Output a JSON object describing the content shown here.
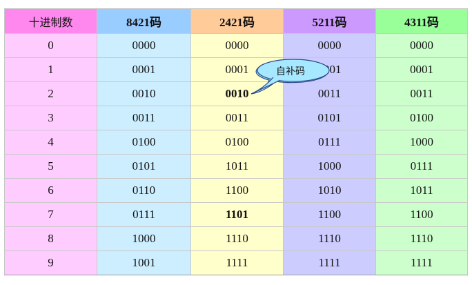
{
  "table": {
    "headers": [
      "十进制数",
      "8421码",
      "2421码",
      "5211码",
      "4311码"
    ],
    "rows": [
      [
        "0",
        "0000",
        "0000",
        "0000",
        "0000"
      ],
      [
        "1",
        "0001",
        "0001",
        "0001",
        "0001"
      ],
      [
        "2",
        "0010",
        "0010",
        "0011",
        "0011"
      ],
      [
        "3",
        "0011",
        "0011",
        "0101",
        "0100"
      ],
      [
        "4",
        "0100",
        "0100",
        "0111",
        "1000"
      ],
      [
        "5",
        "0101",
        "1011",
        "1000",
        "0111"
      ],
      [
        "6",
        "0110",
        "1100",
        "1010",
        "1011"
      ],
      [
        "7",
        "0111",
        "1101",
        "1100",
        "1100"
      ],
      [
        "8",
        "1000",
        "1110",
        "1110",
        "1110"
      ],
      [
        "9",
        "1001",
        "1111",
        "1111",
        "1111"
      ]
    ],
    "highlighted_cells": [
      {
        "row": 2,
        "col": 2
      },
      {
        "row": 7,
        "col": 2
      }
    ],
    "header_colors": [
      "#ff88ee",
      "#99ccff",
      "#ffcc99",
      "#cc99ff",
      "#99ff99"
    ],
    "body_colors": [
      "#ffccff",
      "#cceeff",
      "#ffffcc",
      "#ccccff",
      "#ccffcc"
    ],
    "highlight_color": "#dd0000"
  },
  "callout": {
    "text": "自补码",
    "fill": "#a6e8ff"
  }
}
